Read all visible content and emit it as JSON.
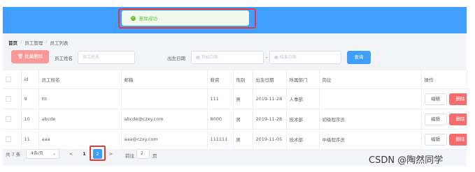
{
  "toast": {
    "message": "删除成功",
    "icon": "check-circle-icon",
    "color": "#67c23a"
  },
  "breadcrumb": {
    "items": [
      "首页",
      "员工管理",
      "员工列表"
    ],
    "separator": "/"
  },
  "toolbar": {
    "batch_delete_label": "批量删除",
    "name_label": "员工姓名",
    "name_placeholder": "员工姓名",
    "birth_label": "出生日期",
    "start_placeholder": "开始日期",
    "range_separator": "-",
    "end_placeholder": "结束日期",
    "query_label": "查询"
  },
  "table": {
    "headers": [
      "",
      "id",
      "员工姓名",
      "邮箱",
      "薪资",
      "性别",
      "出生日期",
      "所属部门",
      "岗位",
      "操作"
    ],
    "edit_label": "编辑",
    "delete_label": "删除",
    "rows": [
      {
        "id": "9",
        "name": "ttt",
        "email": "",
        "salary": "111",
        "gender": "男",
        "birth": "2019-11-28",
        "dept": "人事部",
        "job": ""
      },
      {
        "id": "10",
        "name": "abcde",
        "email": "abcde@czxy.com",
        "salary": "8000",
        "gender": "男",
        "birth": "2019-11-28",
        "dept": "技术部",
        "job": "初级程序员"
      },
      {
        "id": "11",
        "name": "aaa",
        "email": "aaa@czxy.com",
        "salary": "111111",
        "gender": "男",
        "birth": "2019-11-05",
        "dept": "技术部",
        "job": "中级程序员"
      }
    ]
  },
  "pagination": {
    "total_text": "共 7 条",
    "page_size": "4条/页",
    "prev": "<",
    "pages": [
      "1",
      "2"
    ],
    "current_page": "2",
    "next": ">",
    "goto_label": "前往",
    "goto_value": "2",
    "goto_suffix": "页"
  },
  "watermark": "CSDN @陶然同学",
  "colors": {
    "primary": "#409eff",
    "danger": "#f56c6c",
    "highlight": "#e5383b"
  }
}
